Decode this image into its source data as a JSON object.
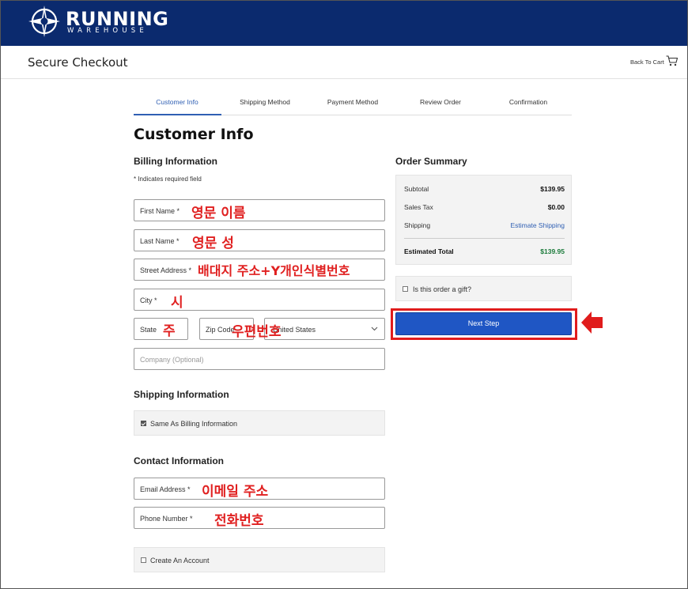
{
  "brand": {
    "name_line1": "RUNNING",
    "name_line2": "WAREHOUSE"
  },
  "header": {
    "title": "Secure Checkout",
    "back_to_cart": "Back To Cart"
  },
  "steps": [
    {
      "label": "Customer Info",
      "active": true
    },
    {
      "label": "Shipping Method",
      "active": false
    },
    {
      "label": "Payment Method",
      "active": false
    },
    {
      "label": "Review Order",
      "active": false
    },
    {
      "label": "Confirmation",
      "active": false
    }
  ],
  "page_title": "Customer Info",
  "billing": {
    "heading": "Billing Information",
    "required_note": "* Indicates required field",
    "first_name": "First Name *",
    "last_name": "Last Name *",
    "street": "Street Address *",
    "city": "City *",
    "state": "State",
    "zip": "Zip Code",
    "country": "United States",
    "company": "Company (Optional)"
  },
  "shipping": {
    "heading": "Shipping Information",
    "same_as_billing": "Same As Billing Information",
    "same_checked": true
  },
  "contact": {
    "heading": "Contact Information",
    "email": "Email Address *",
    "phone": "Phone Number *",
    "create_account": "Create An Account"
  },
  "summary": {
    "heading": "Order Summary",
    "subtotal_label": "Subtotal",
    "subtotal_value": "$139.95",
    "tax_label": "Sales Tax",
    "tax_value": "$0.00",
    "shipping_label": "Shipping",
    "shipping_value": "Estimate Shipping",
    "total_label": "Estimated Total",
    "total_value": "$139.95",
    "gift_label": "Is this order a gift?",
    "next_button": "Next Step"
  },
  "annotations": {
    "first_name": "영문 이름",
    "last_name": "영문 성",
    "street": "배대지 주소+Y개인식별번호",
    "city": "시",
    "state": "주",
    "zip": "우편번호",
    "email": "이메일 주소",
    "phone": "전화번호"
  },
  "colors": {
    "header_bg": "#0b2a6e",
    "accent": "#2f5fb3",
    "button": "#1f56c4",
    "annotation": "#e02020",
    "total_green": "#1a7a3a"
  }
}
